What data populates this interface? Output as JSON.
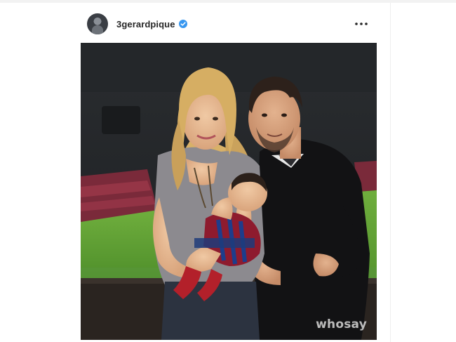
{
  "post": {
    "username": "3gerardpique",
    "verified": true,
    "menu_icon": "more-horizontal-icon",
    "photo_watermark": "whosay"
  },
  "colors": {
    "text_primary": "#262626",
    "verified_badge": "#3897f0",
    "page_background": "#ffffff"
  }
}
